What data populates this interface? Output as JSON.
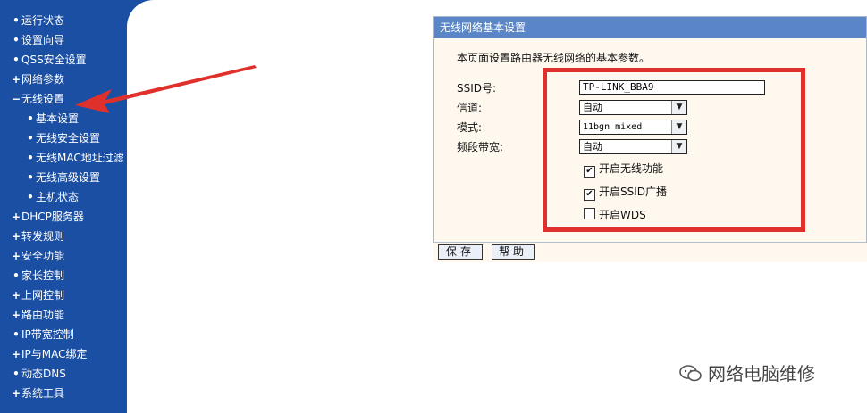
{
  "sidebar": {
    "items": [
      {
        "marker": "•",
        "label": "运行状态",
        "level": 0
      },
      {
        "marker": "•",
        "label": "设置向导",
        "level": 0
      },
      {
        "marker": "•",
        "label": "QSS安全设置",
        "level": 0
      },
      {
        "marker": "+",
        "label": "网络参数",
        "level": 0
      },
      {
        "marker": "−",
        "label": "无线设置",
        "level": 0,
        "active": true
      },
      {
        "marker": "•",
        "label": "基本设置",
        "level": 1
      },
      {
        "marker": "•",
        "label": "无线安全设置",
        "level": 1
      },
      {
        "marker": "•",
        "label": "无线MAC地址过滤",
        "level": 1
      },
      {
        "marker": "•",
        "label": "无线高级设置",
        "level": 1
      },
      {
        "marker": "•",
        "label": "主机状态",
        "level": 1
      },
      {
        "marker": "+",
        "label": "DHCP服务器",
        "level": 0
      },
      {
        "marker": "+",
        "label": "转发规则",
        "level": 0
      },
      {
        "marker": "+",
        "label": "安全功能",
        "level": 0
      },
      {
        "marker": "•",
        "label": "家长控制",
        "level": 0
      },
      {
        "marker": "+",
        "label": "上网控制",
        "level": 0
      },
      {
        "marker": "+",
        "label": "路由功能",
        "level": 0
      },
      {
        "marker": "•",
        "label": "IP带宽控制",
        "level": 0
      },
      {
        "marker": "+",
        "label": "IP与MAC绑定",
        "level": 0
      },
      {
        "marker": "•",
        "label": "动态DNS",
        "level": 0
      },
      {
        "marker": "+",
        "label": "系统工具",
        "level": 0
      }
    ]
  },
  "panel": {
    "title": "无线网络基本设置",
    "description": "本页面设置路由器无线网络的基本参数。",
    "ssid_label": "SSID号:",
    "ssid_value": "TP-LINK_BBA9",
    "channel_label": "信道:",
    "channel_value": "自动",
    "mode_label": "模式:",
    "mode_value": "11bgn mixed",
    "bandwidth_label": "频段带宽:",
    "bandwidth_value": "自动",
    "enable_wireless_label": "开启无线功能",
    "enable_wireless_checked": true,
    "enable_ssid_broadcast_label": "开启SSID广播",
    "enable_ssid_broadcast_checked": true,
    "enable_wds_label": "开启WDS",
    "enable_wds_checked": false,
    "save_label": "保存",
    "help_label": "帮助"
  },
  "watermark": {
    "text": "网络电脑维修"
  },
  "colors": {
    "sidebar_bg": "#1a4fa3",
    "panel_title_bg": "#5a86c7",
    "highlight_red": "#e0302b"
  }
}
